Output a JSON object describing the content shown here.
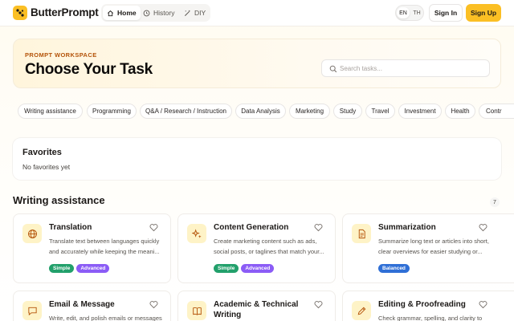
{
  "header": {
    "brand": "ButterPrompt",
    "nav": [
      {
        "label": "Home",
        "icon": "home-icon",
        "active": true
      },
      {
        "label": "History",
        "icon": "clock-icon",
        "active": false
      },
      {
        "label": "DIY",
        "icon": "wand-icon",
        "active": false
      }
    ],
    "lang": [
      "EN",
      "TH"
    ],
    "signin": "Sign In",
    "signup": "Sign Up"
  },
  "hero": {
    "eyebrow": "PROMPT WORKSPACE",
    "title": "Choose Your Task",
    "search_placeholder": "Search tasks..."
  },
  "categories": [
    "Writing assistance",
    "Programming",
    "Q&A / Research / Instruction",
    "Data Analysis",
    "Marketing",
    "Study",
    "Travel",
    "Investment",
    "Health",
    "Contr"
  ],
  "favorites": {
    "title": "Favorites",
    "empty": "No favorites yet"
  },
  "section": {
    "title": "Writing assistance",
    "count": "7"
  },
  "cards": [
    {
      "title": "Translation",
      "desc": "Translate text between languages quickly and accurately while keeping the meani...",
      "icon": "globe-icon",
      "tags": [
        "Simple",
        "Advanced"
      ]
    },
    {
      "title": "Content Generation",
      "desc": "Create marketing content such as ads, social posts, or taglines that match your...",
      "icon": "sparkle-icon",
      "tags": [
        "Simple",
        "Advanced"
      ]
    },
    {
      "title": "Summarization",
      "desc": "Summarize long text or articles into short, clear overviews for easier studying or...",
      "icon": "document-icon",
      "tags": [
        "Balanced"
      ]
    },
    {
      "title": "Email & Message",
      "desc": "Write, edit, and polish emails or messages",
      "icon": "message-icon",
      "tags": []
    },
    {
      "title": "Academic & Technical Writing",
      "desc": "",
      "icon": "book-icon",
      "tags": []
    },
    {
      "title": "Editing & Proofreading",
      "desc": "Check grammar, spelling, and clarity to",
      "icon": "pen-icon",
      "tags": []
    }
  ],
  "colors": {
    "accent": "#fbbf24",
    "simple": "#22a06b",
    "advanced": "#8b5cf6",
    "balanced": "#2f6fd6"
  }
}
